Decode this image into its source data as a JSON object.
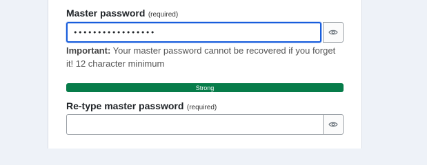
{
  "master_password": {
    "label": "Master password",
    "required_tag": "(required)",
    "value": "•••••••••••••••••",
    "help_strong": "Important:",
    "help_text": " Your master password cannot be recovered if you forget it! 12 character minimum"
  },
  "strength_meter": {
    "label": "Strong",
    "level_percent": 100,
    "color": "#077c4a"
  },
  "retype_password": {
    "label": "Re-type master password",
    "required_tag": "(required)",
    "value": ""
  },
  "icons": {
    "toggle_visibility": "eye-icon"
  }
}
